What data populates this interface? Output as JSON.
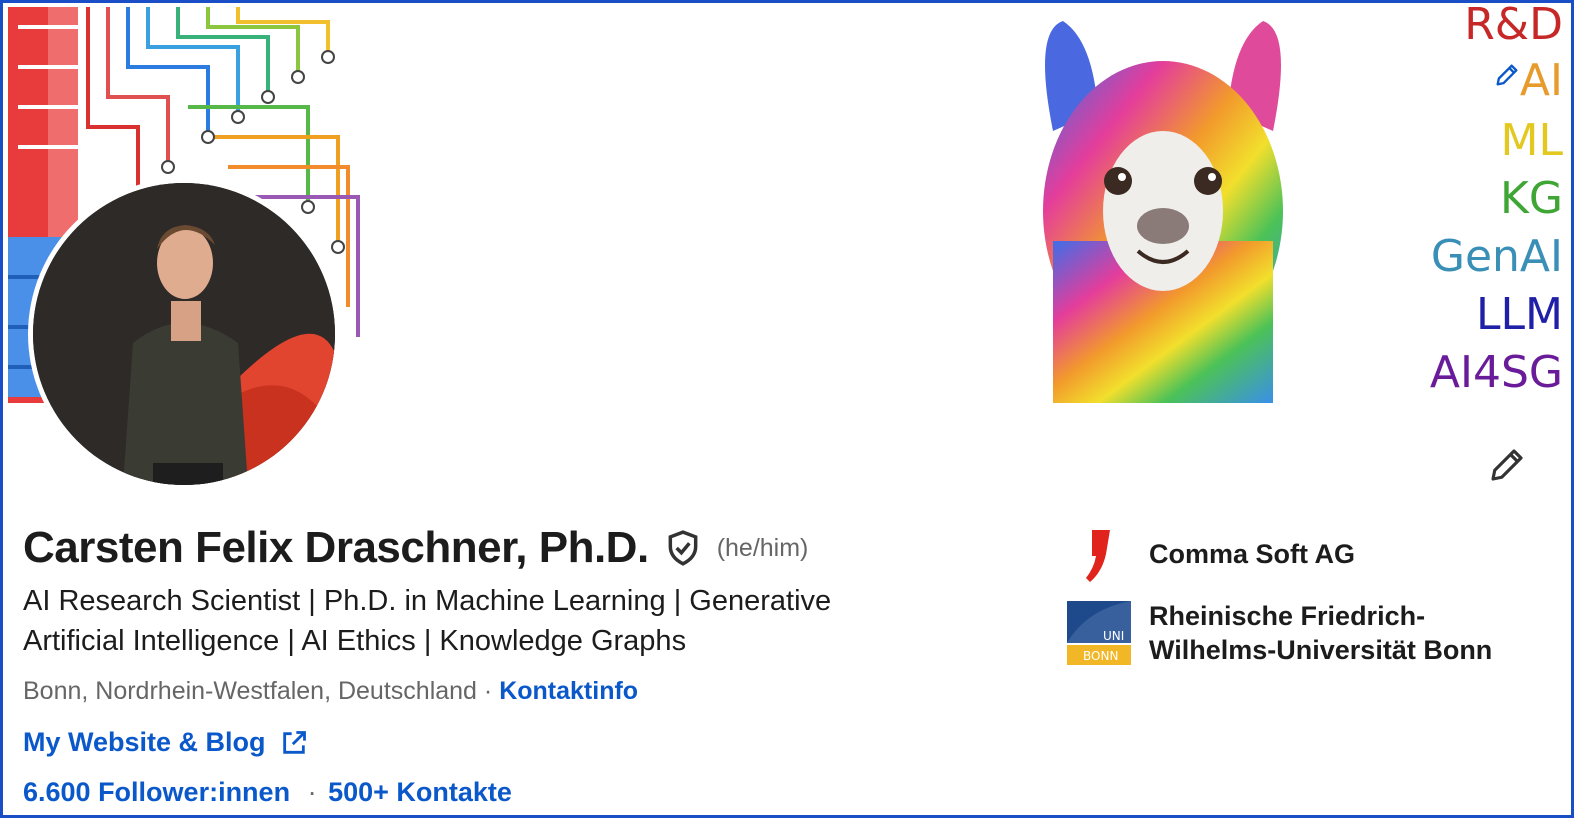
{
  "profile": {
    "name": "Carsten Felix Draschner, Ph.D.",
    "pronouns": "(he/him)",
    "headline": "AI Research Scientist | Ph.D. in Machine Learning | Generative Artificial Intelligence | AI Ethics | Knowledge Graphs",
    "location": "Bonn, Nordrhein-Westfalen, Deutschland",
    "separator": "·",
    "contact_info_label": "Kontaktinfo",
    "website_label": "My Website & Blog",
    "followers_label": "6.600 Follower:innen",
    "connections_label": "500+ Kontakte"
  },
  "banner": {
    "tags": [
      {
        "text": "R&D",
        "color": "#c62828"
      },
      {
        "text": "AI",
        "color": "#e69b2c"
      },
      {
        "text": "ML",
        "color": "#e3c91f"
      },
      {
        "text": "KG",
        "color": "#3fa535"
      },
      {
        "text": "GenAI",
        "color": "#3a8fb7"
      },
      {
        "text": "LLM",
        "color": "#1f1fa8"
      },
      {
        "text": "AI4SG",
        "color": "#6a1b9a"
      }
    ]
  },
  "companies": [
    {
      "name": "Comma Soft AG",
      "logo": "comma-logo",
      "color": "#e0231c"
    },
    {
      "name": "Rheinische Friedrich-Wilhelms-Universität Bonn",
      "logo": "uni-bonn-logo",
      "logo_text_top": "UNI",
      "logo_text_bottom": "BONN"
    }
  ],
  "colors": {
    "accent": "#0a58ca",
    "frame": "#1a4ec6"
  }
}
